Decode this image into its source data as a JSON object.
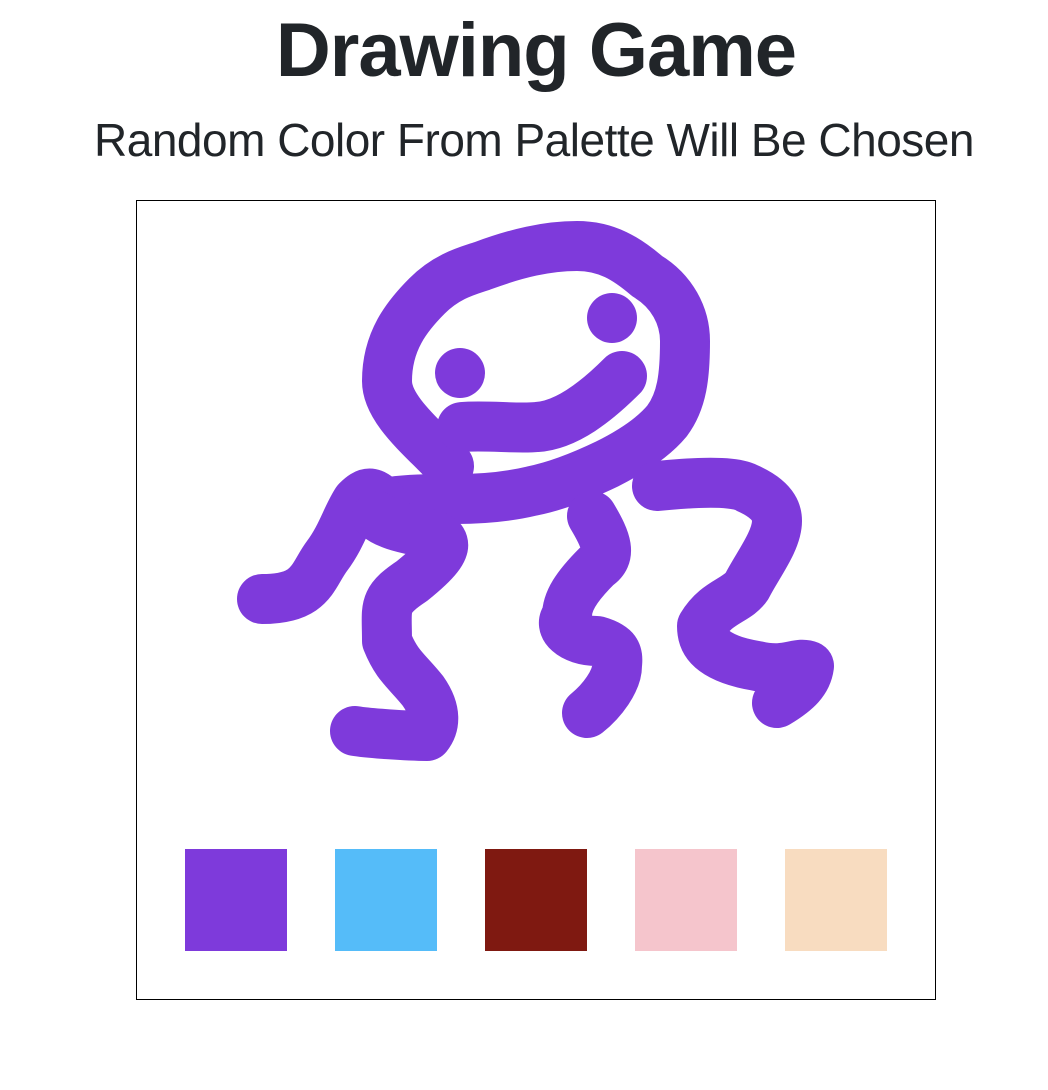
{
  "header": {
    "title": "Drawing Game",
    "subtitle": "Random Color From Palette Will Be Chosen"
  },
  "drawing": {
    "stroke_color": "#7e3adb"
  },
  "palette": [
    {
      "name": "purple",
      "color": "#7e3adb"
    },
    {
      "name": "light-blue",
      "color": "#55bcf9"
    },
    {
      "name": "dark-red",
      "color": "#7f1911"
    },
    {
      "name": "pink",
      "color": "#f5c5cc"
    },
    {
      "name": "peach",
      "color": "#f8dcc0"
    }
  ]
}
